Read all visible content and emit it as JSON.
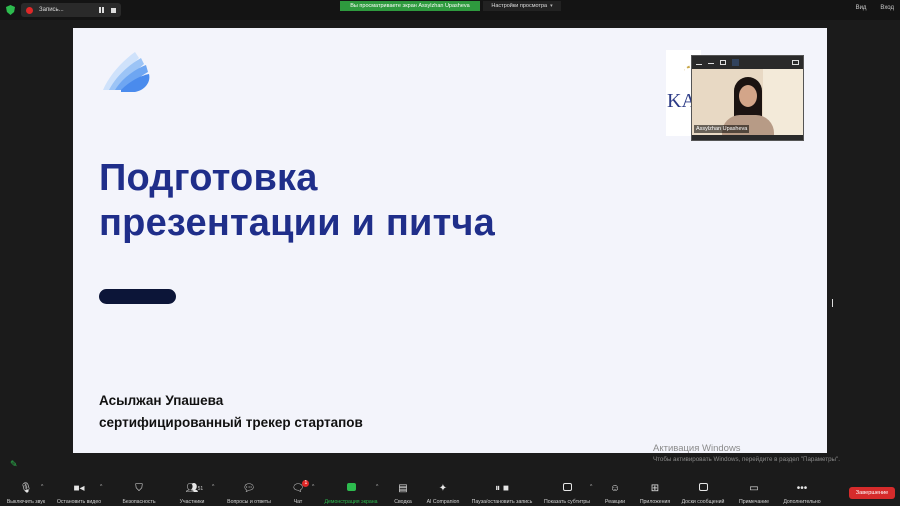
{
  "topbar": {
    "recording_label": "Запись...",
    "viewing_banner": "Вы просматриваете экран Assylzhan Upasheva",
    "view_options": "Настройки просмотра",
    "view_mode": "Вид",
    "fullscreen": "Вход"
  },
  "slide": {
    "title_line1": "Подготовка",
    "title_line2": "презентации и питча",
    "author_name": "Асылжан Упашева",
    "author_role": "сертифицированный трекер стартапов",
    "partner_logo_text": "KA"
  },
  "video": {
    "participant_name": "Assylzhan Upasheva"
  },
  "watermark": {
    "line1": "Активация Windows",
    "line2": "Чтобы активировать Windows, перейдите в раздел \"Параметры\"."
  },
  "toolbar": {
    "mute": "Выключить звук",
    "stop_video": "Остановить видео",
    "security": "Безопасность",
    "participants": "Участники",
    "participants_count": "51",
    "qa": "Вопросы и ответы",
    "chat": "Чат",
    "chat_badge": "1",
    "share_screen": "Демонстрация экрана",
    "summary": "Сводка",
    "ai_companion": "AI Companion",
    "pause_recording": "Пауза/остановить запись",
    "subtitles": "Показать субтитры",
    "reactions": "Реакции",
    "apps": "Приложения",
    "whiteboard": "Доски сообщений",
    "notes": "Примечание",
    "more": "Дополнительно",
    "end": "Завершение"
  },
  "colors": {
    "title_blue": "#1f2e8a",
    "zoom_green": "#2dbb4e",
    "end_red": "#d62b2b"
  }
}
